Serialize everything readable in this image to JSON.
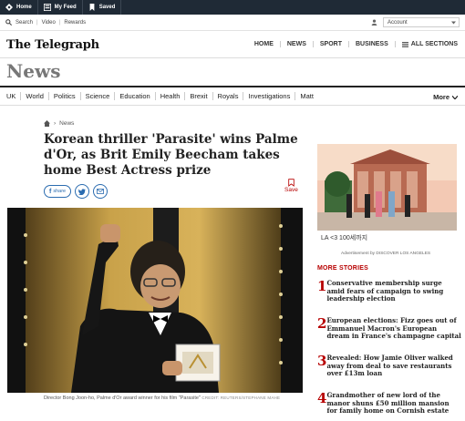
{
  "topbar": {
    "items": [
      {
        "label": "Home",
        "icon": "home-icon"
      },
      {
        "label": "My Feed",
        "icon": "feed-icon"
      },
      {
        "label": "Saved",
        "icon": "bookmark-icon"
      }
    ]
  },
  "utilbar": {
    "search": "Search",
    "video": "Video",
    "rewards": "Rewards",
    "account": "Account"
  },
  "masthead": {
    "logo": "The Telegraph",
    "nav": [
      "HOME",
      "NEWS",
      "SPORT",
      "BUSINESS",
      "ALL SECTIONS"
    ]
  },
  "section": {
    "title": "News",
    "subnav": [
      "UK",
      "World",
      "Politics",
      "Science",
      "Education",
      "Health",
      "Brexit",
      "Royals",
      "Investigations",
      "Matt"
    ],
    "more": "More"
  },
  "article": {
    "breadcrumb": "News",
    "headline": "Korean thriller 'Parasite' wins Palme d'Or, as Brit Emily Beecham takes home Best Actress prize",
    "share_label": "share",
    "save_label": "Save",
    "caption": "Director Bong Joon-ho, Palme d'Or award winner for his film \"Parasite\"",
    "credit": "CREDIT: REUTERS/STEPHANE MAHE"
  },
  "sidebar": {
    "ad_text": "LA <3 100세까지",
    "ad_note": "Advertisement by DISCOVER LOS ANGELES",
    "more_stories_label": "MORE STORIES",
    "stories": [
      {
        "num": "1",
        "title": "Conservative membership surge amid fears of campaign to swing leadership election"
      },
      {
        "num": "2",
        "title": "European elections: Fizz goes out of Emmanuel Macron's European dream in France's champagne capital"
      },
      {
        "num": "3",
        "title": "Revealed: How Jamie Oliver walked away from deal to save restaurants over £13m loan"
      },
      {
        "num": "4",
        "title": "Grandmother of new lord of the manor shuns £50 million mansion for family home on Cornish estate"
      }
    ]
  },
  "colors": {
    "topbar": "#1f2a36",
    "accent_red": "#b70000",
    "share_blue": "#2b6cb0"
  }
}
